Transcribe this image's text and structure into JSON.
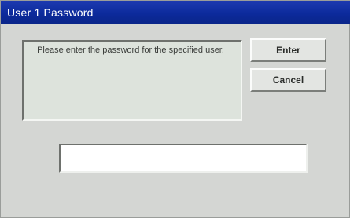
{
  "window": {
    "title": "User 1 Password"
  },
  "message": {
    "text": "Please enter the password for the specified user."
  },
  "buttons": {
    "enter_label": "Enter",
    "cancel_label": "Cancel"
  },
  "password_field": {
    "value": ""
  },
  "colors": {
    "titlebar": "#0c2a9c",
    "dialog_background": "#d4d6d3",
    "input_background": "#ffffff"
  }
}
